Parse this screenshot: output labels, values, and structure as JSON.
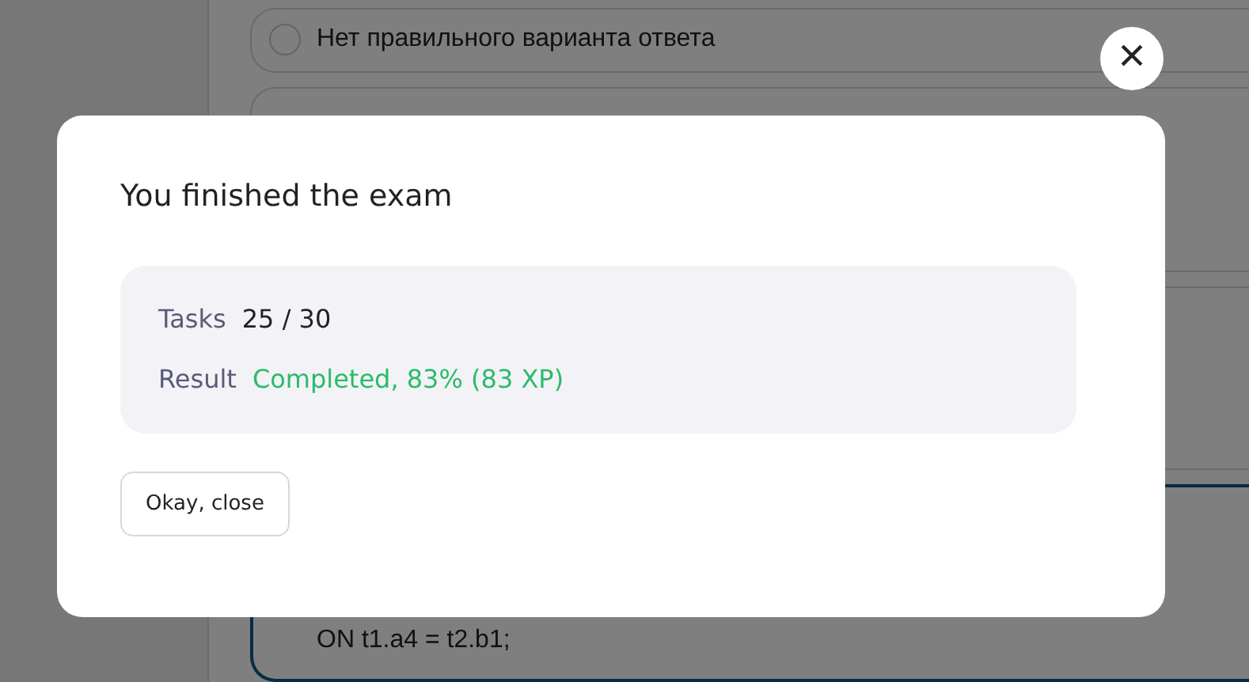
{
  "answers": [
    {
      "text": "Нет правильного варианта ответа",
      "selected": false
    },
    {
      "selected": false
    },
    {
      "selected": false
    },
    {
      "code": [
        "ON t1.a4 = t2.b1;"
      ],
      "selected": true
    }
  ],
  "modal": {
    "title": "You finished the exam",
    "stats": [
      {
        "label": "Tasks",
        "value": "25 / 30",
        "color": "#222222"
      },
      {
        "label": "Result",
        "value": "Completed, 83% (83 XP)",
        "color": "#2bbb6a"
      }
    ],
    "button": "Okay, close",
    "close": "×"
  }
}
